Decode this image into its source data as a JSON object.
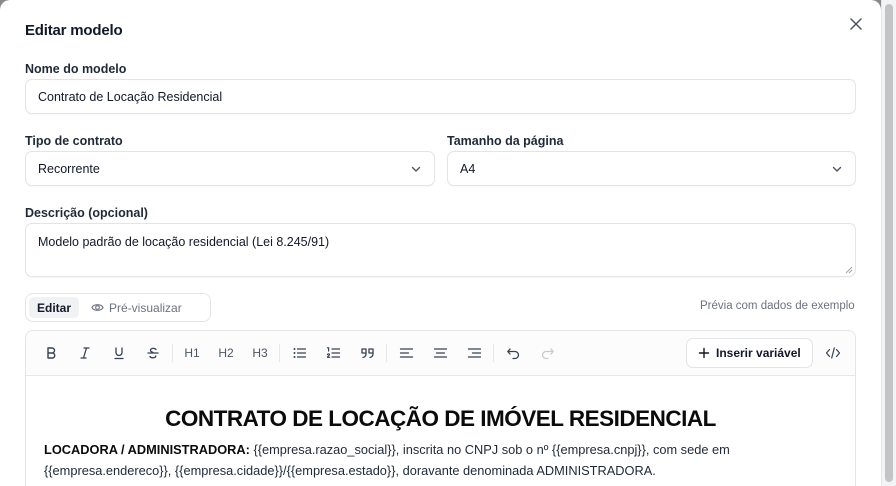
{
  "modal": {
    "title": "Editar modelo"
  },
  "form": {
    "name_label": "Nome do modelo",
    "name_value": "Contrato de Locação Residencial",
    "type_label": "Tipo de contrato",
    "type_value": "Recorrente",
    "page_size_label": "Tamanho da página",
    "page_size_value": "A4",
    "description_label": "Descrição (opcional)",
    "description_value": "Modelo padrão de locação residencial (Lei 8.245/91)"
  },
  "tabs": {
    "edit_label": "Editar",
    "preview_label": "Pré-visualizar",
    "preview_hint": "Prévia com dados de exemplo"
  },
  "toolbar": {
    "insert_variable_label": "Inserir variável",
    "icons": [
      "bold-icon",
      "italic-icon",
      "underline-icon",
      "strikethrough-icon",
      "heading-1",
      "heading-2",
      "heading-3",
      "bullet-list-icon",
      "ordered-list-icon",
      "blockquote-icon",
      "align-left-icon",
      "align-center-icon",
      "align-right-icon",
      "undo-icon",
      "redo-icon",
      "code-icon"
    ],
    "h1": "H1",
    "h2": "H2",
    "h3": "H3"
  },
  "document": {
    "title": "CONTRATO DE LOCAÇÃO DE IMÓVEL RESIDENCIAL",
    "party_label": "LOCADORA / ADMINISTRADORA:",
    "party_text": " {{empresa.razao_social}}, inscrita no CNPJ sob o nº {{empresa.cnpj}}, com sede em {{empresa.endereco}}, {{empresa.cidade}}/{{empresa.estado}}, doravante denominada ADMINISTRADORA."
  }
}
